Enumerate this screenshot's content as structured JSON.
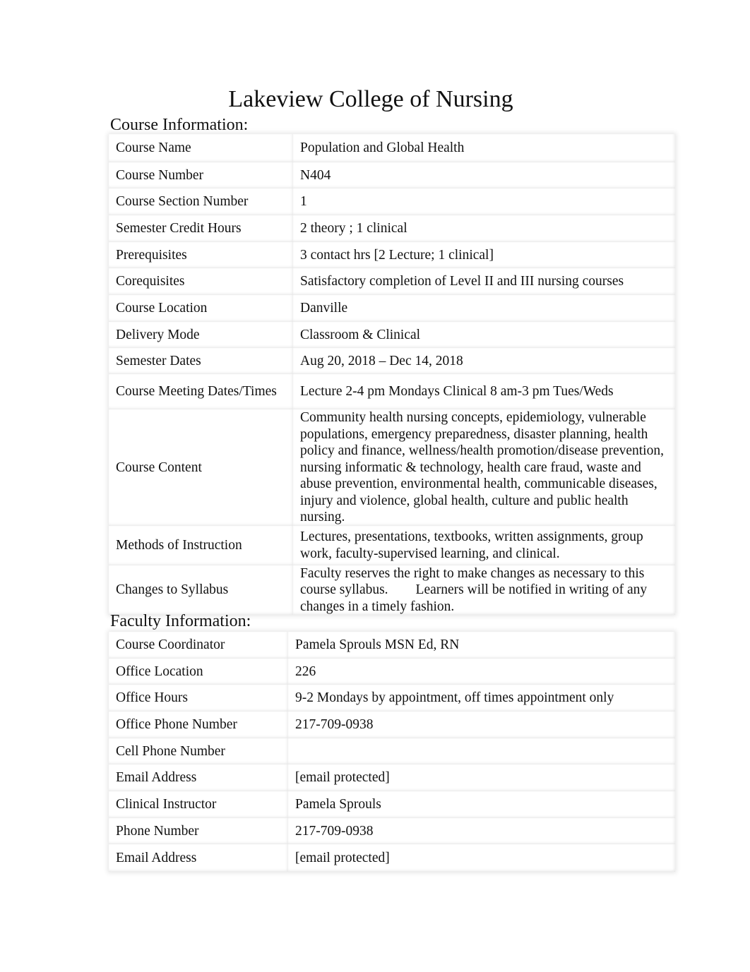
{
  "title": "Lakeview College of Nursing",
  "course_section": {
    "heading": "Course Information:",
    "rows": [
      {
        "label": "Course Name",
        "value": "Population and Global Health"
      },
      {
        "label": "Course Number",
        "value": "N404"
      },
      {
        "label": "Course Section Number",
        "value": "1"
      },
      {
        "label": "Semester Credit Hours",
        "value": "2 theory ; 1 clinical"
      },
      {
        "label": "Prerequisites",
        "value": "3 contact hrs [2 Lecture; 1 clinical]"
      },
      {
        "label": "Corequisites",
        "value": "Satisfactory completion of Level II and III nursing courses"
      },
      {
        "label": "Course Location",
        "value": "Danville"
      },
      {
        "label": "Delivery Mode",
        "value": "Classroom & Clinical"
      },
      {
        "label": "Semester Dates",
        "value": "Aug 20, 2018 – Dec 14, 2018"
      },
      {
        "label": "Course Meeting Dates/Times",
        "value": "Lecture 2-4 pm Mondays Clinical 8 am-3 pm Tues/Weds"
      },
      {
        "label": "Course Content",
        "value": "Community health nursing concepts, epidemiology, vulnerable populations, emergency preparedness, disaster planning, health policy and finance, wellness/health promotion/disease prevention, nursing informatic & technology, health care fraud, waste and abuse prevention, environmental health, communicable diseases, injury and violence, global health, culture and public health nursing."
      },
      {
        "label": "Methods of Instruction",
        "value": "Lectures, presentations, textbooks, written assignments, group work, faculty-supervised learning, and clinical."
      },
      {
        "label": "Changes to Syllabus",
        "value": "Faculty reserves the right to make changes as necessary to this course syllabus.        Learners will be notified in writing of any changes in a timely fashion."
      }
    ]
  },
  "faculty_section": {
    "heading": "Faculty Information:",
    "rows": [
      {
        "label": "Course Coordinator",
        "value": "Pamela Sprouls MSN Ed, RN"
      },
      {
        "label": "Office Location",
        "value": "226"
      },
      {
        "label": "Office Hours",
        "value": "9-2 Mondays by appointment, off times appointment only"
      },
      {
        "label": "Office Phone Number",
        "value": "217-709-0938"
      },
      {
        "label": "Cell Phone Number",
        "value": ""
      },
      {
        "label": "Email Address",
        "value": "[email protected]"
      },
      {
        "label": "Clinical Instructor",
        "value": "Pamela Sprouls"
      },
      {
        "label": "Phone Number",
        "value": "217-709-0938"
      },
      {
        "label": "Email Address",
        "value": "[email protected]"
      }
    ]
  }
}
